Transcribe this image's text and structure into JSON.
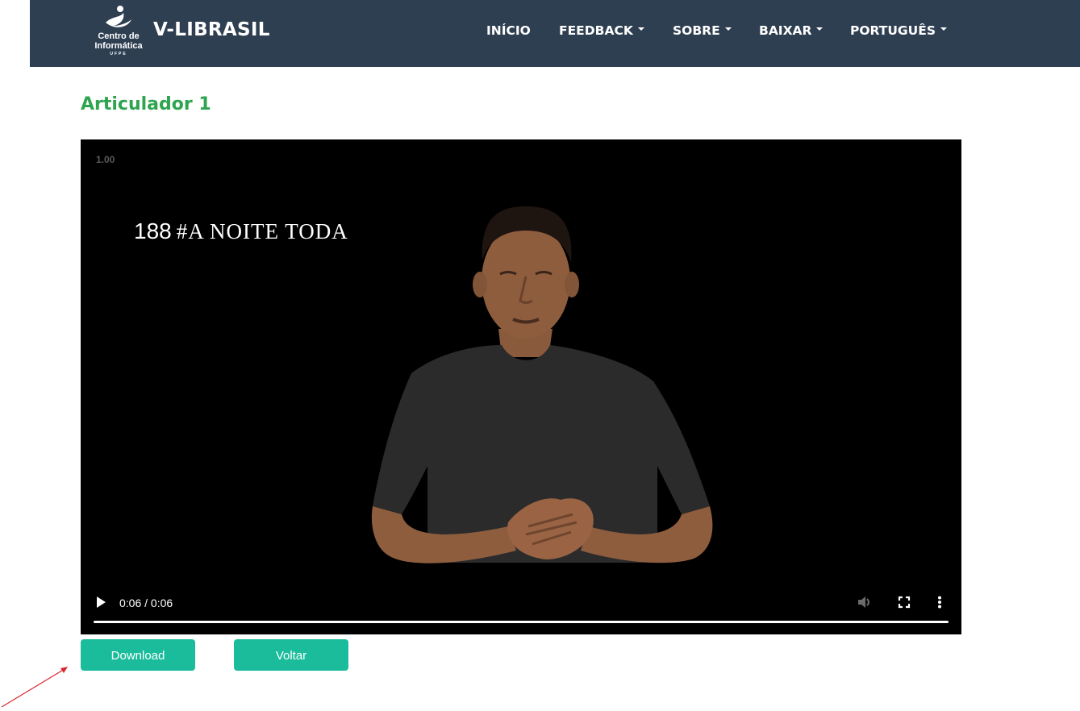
{
  "nav": {
    "logo": {
      "line1": "Centro de",
      "line2": "Informática",
      "line3": "UFPE"
    },
    "brand": "V-LIBRASIL",
    "items": [
      {
        "label": "INÍCIO",
        "has_dropdown": false
      },
      {
        "label": "FEEDBACK",
        "has_dropdown": true
      },
      {
        "label": "SOBRE",
        "has_dropdown": true
      },
      {
        "label": "BAIXAR",
        "has_dropdown": true
      },
      {
        "label": "PORTUGUÊS",
        "has_dropdown": true
      }
    ]
  },
  "page": {
    "title": "Articulador 1"
  },
  "video": {
    "speed_label": "1.00",
    "caption_number": "188",
    "caption_text": "#A NOITE TODA",
    "time": "0:06 / 0:06",
    "progress": 1.0
  },
  "buttons": {
    "download": "Download",
    "back": "Voltar"
  },
  "colors": {
    "navbar": "#2f3f52",
    "title": "#2ea44f",
    "button": "#1abc9c",
    "annotation_arrow": "#d9262c"
  },
  "icons": {
    "play": "play-icon",
    "volume": "volume-icon",
    "fullscreen": "fullscreen-icon",
    "more": "more-vertical-icon"
  }
}
